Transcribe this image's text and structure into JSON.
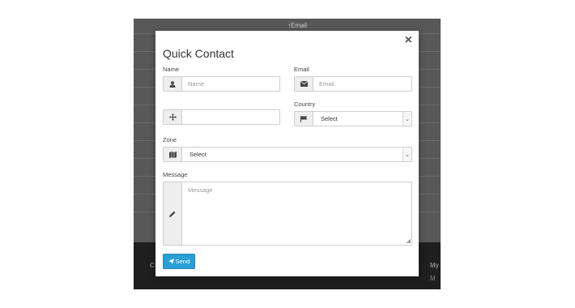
{
  "background": {
    "email_header": "Email",
    "footer_texts": [
      "C",
      "My",
      "M"
    ]
  },
  "modal": {
    "title": "Quick Contact",
    "close_label": "×",
    "name": {
      "label": "Name",
      "placeholder": "Name",
      "icon": "user-icon"
    },
    "email": {
      "label": "Email",
      "placeholder": "Email",
      "icon": "envelope-icon"
    },
    "third": {
      "value": "",
      "icon": "move-icon"
    },
    "country": {
      "label": "Country",
      "selected": "Select",
      "icon": "flag-icon"
    },
    "zone": {
      "label": "Zone",
      "selected": "Select",
      "icon": "map-icon"
    },
    "message": {
      "label": "Message",
      "placeholder": "Message",
      "icon": "pencil-icon"
    },
    "send_label": "Send"
  }
}
